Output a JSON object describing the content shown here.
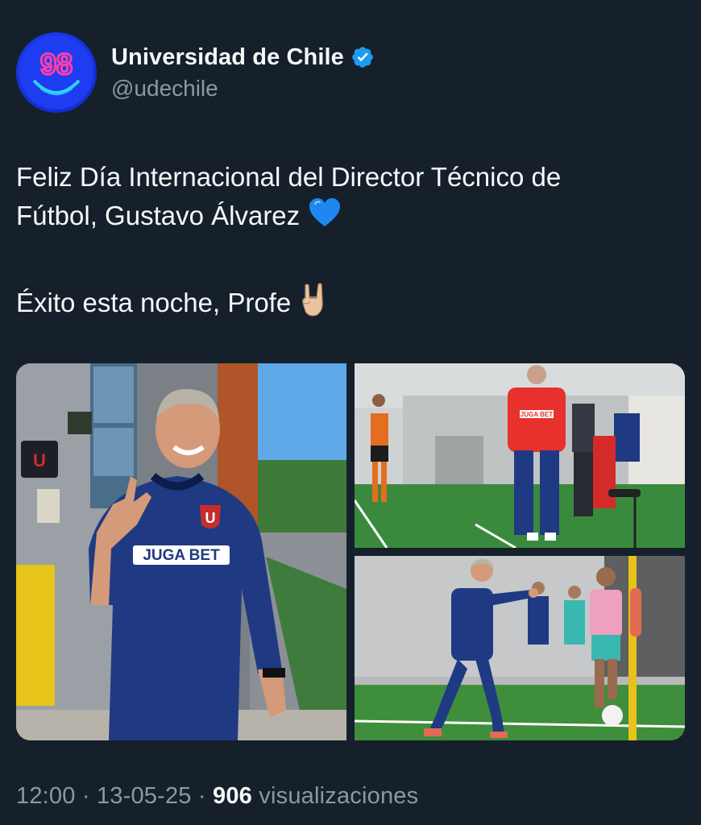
{
  "account": {
    "display_name": "Universidad de Chile",
    "handle": "@udechile",
    "avatar_icon": "u98-logo-icon",
    "avatar_text": "98",
    "verified_icon": "verified-badge-icon",
    "verified_color": "#1d9bf0"
  },
  "post": {
    "line1": "Feliz Día Internacional del Director Técnico de",
    "line2": "Fútbol, Gustavo Álvarez",
    "line2_emoji": "blue-heart-icon",
    "line3": "Éxito esta noche, Profe",
    "line3_emoji": "sign-of-horns-icon"
  },
  "media": {
    "photos": [
      {
        "name": "coach-horns-gesture-photo",
        "shirt_text": "JUGA BET"
      },
      {
        "name": "coach-training-pitch-photo",
        "shirt_text": "JUGA BET"
      },
      {
        "name": "coach-pointing-photo",
        "shirt_text": ""
      }
    ]
  },
  "meta": {
    "time": "12:00",
    "separator1": " · ",
    "date": "13-05-25",
    "separator2": " · ",
    "views_count": "906",
    "views_label": " visualizaciones"
  },
  "colors": {
    "background": "#15202b",
    "text_primary": "#f7f9f9",
    "text_secondary": "#8b98a5",
    "accent": "#1d9bf0"
  }
}
